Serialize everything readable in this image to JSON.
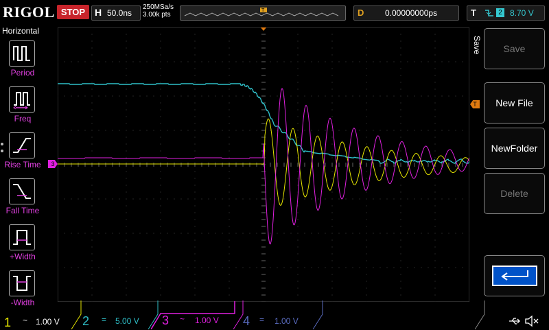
{
  "brand": {
    "logo": "RIGOL"
  },
  "status": {
    "run_state": "STOP"
  },
  "horizontal": {
    "letter": "H",
    "timebase": "50.0ns",
    "sample_rate": "250MSa/s",
    "memory_depth": "3.00k pts"
  },
  "delay": {
    "letter": "D",
    "value": "0.00000000ps"
  },
  "trigger": {
    "letter": "T",
    "source": "2",
    "level": "8.70 V"
  },
  "left_menu": {
    "title": "Horizontal",
    "items": [
      {
        "label": "Period",
        "icon": "period-icon"
      },
      {
        "label": "Freq",
        "icon": "frequency-icon"
      },
      {
        "label": "Rise Time",
        "icon": "rise-time-icon"
      },
      {
        "label": "Fall Time",
        "icon": "fall-time-icon"
      },
      {
        "label": "+Width",
        "icon": "positive-width-icon"
      },
      {
        "label": "-Width",
        "icon": "negative-width-icon"
      }
    ]
  },
  "right_menu": {
    "tab_label": "Save",
    "buttons": [
      {
        "label": "Save",
        "enabled": false
      },
      {
        "label": "New File",
        "enabled": true
      },
      {
        "label": "NewFolder",
        "enabled": true
      },
      {
        "label": "Delete",
        "enabled": false
      }
    ],
    "back_icon": "return-arrow-icon"
  },
  "channels": [
    {
      "num": "1",
      "coupling": "~",
      "scale": "1.00 V",
      "color": "#e6e600"
    },
    {
      "num": "2",
      "coupling": "=",
      "scale": "5.00 V",
      "color": "#2fbfc8"
    },
    {
      "num": "3",
      "coupling": "~",
      "scale": "1.00 V",
      "color": "#e020e0"
    },
    {
      "num": "4",
      "coupling": "=",
      "scale": "1.00 V",
      "color": "#5a6cc0"
    }
  ],
  "markers": {
    "trigger_level": "T",
    "channel3_offset": "3"
  },
  "colors": {
    "ch1": "#e6e600",
    "ch2": "#2fbfc8",
    "ch3": "#e020e0",
    "ch4": "#5a6cc0",
    "grid": "#4a4a4a",
    "stop": "#c8242b",
    "delay": "#e0a020"
  },
  "status_icons": [
    "usb-icon",
    "speaker-mute-icon"
  ]
}
